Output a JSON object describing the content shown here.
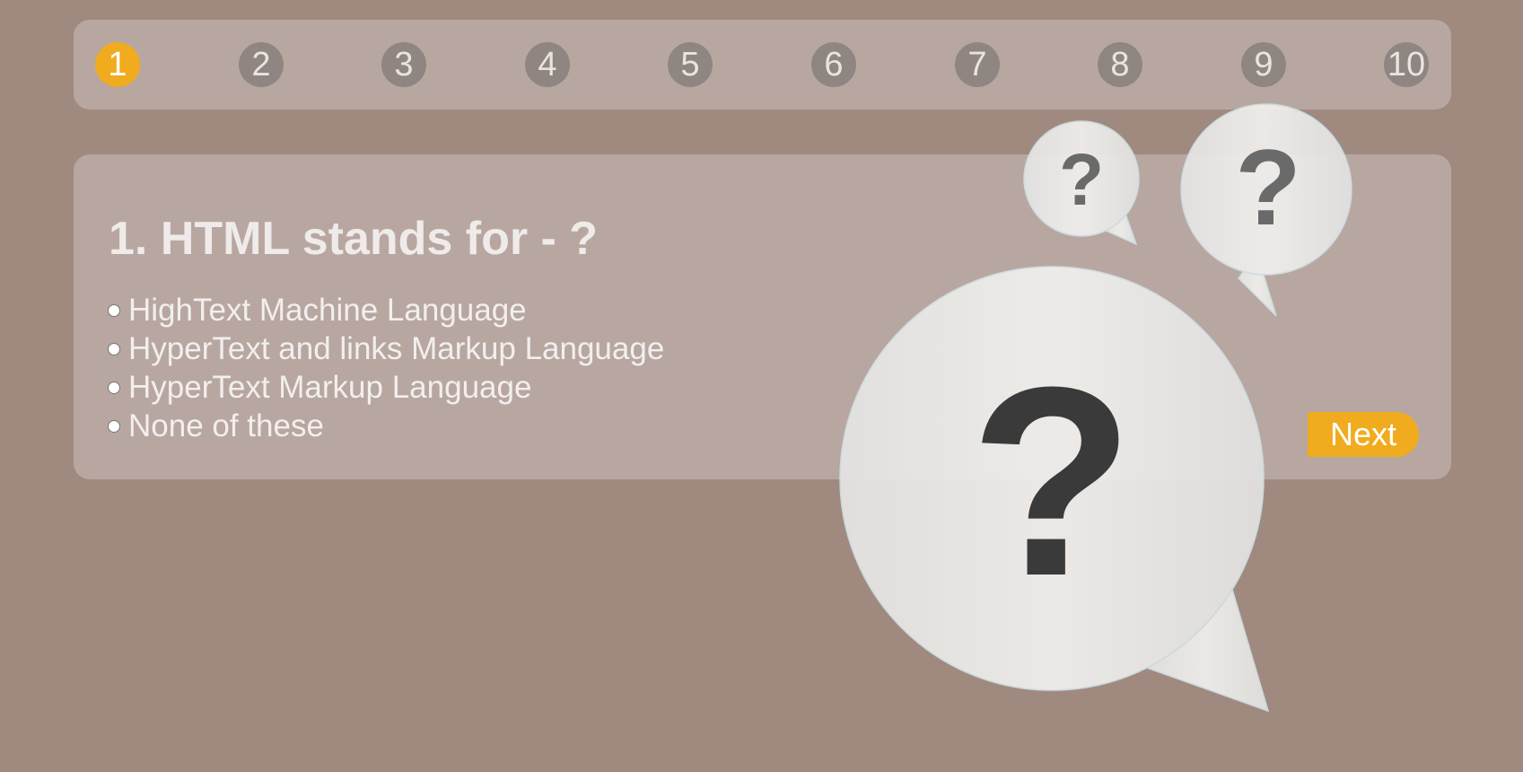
{
  "nav": {
    "steps": [
      "1",
      "2",
      "3",
      "4",
      "5",
      "6",
      "7",
      "8",
      "9",
      "10"
    ],
    "active_step": "1"
  },
  "question": {
    "title": "1. HTML stands for - ?",
    "options": [
      "HighText Machine Language",
      "HyperText and links Markup Language",
      "HyperText Markup Language",
      "None of these"
    ]
  },
  "actions": {
    "next_label": "Next"
  },
  "illustration": {
    "icon": "question-bubbles-illustration",
    "glyph": "?"
  },
  "colors": {
    "background": "#a08a80",
    "accent": "#f0ac1e",
    "step_inactive": "#8f8581",
    "bubble": "#eeedeb"
  }
}
